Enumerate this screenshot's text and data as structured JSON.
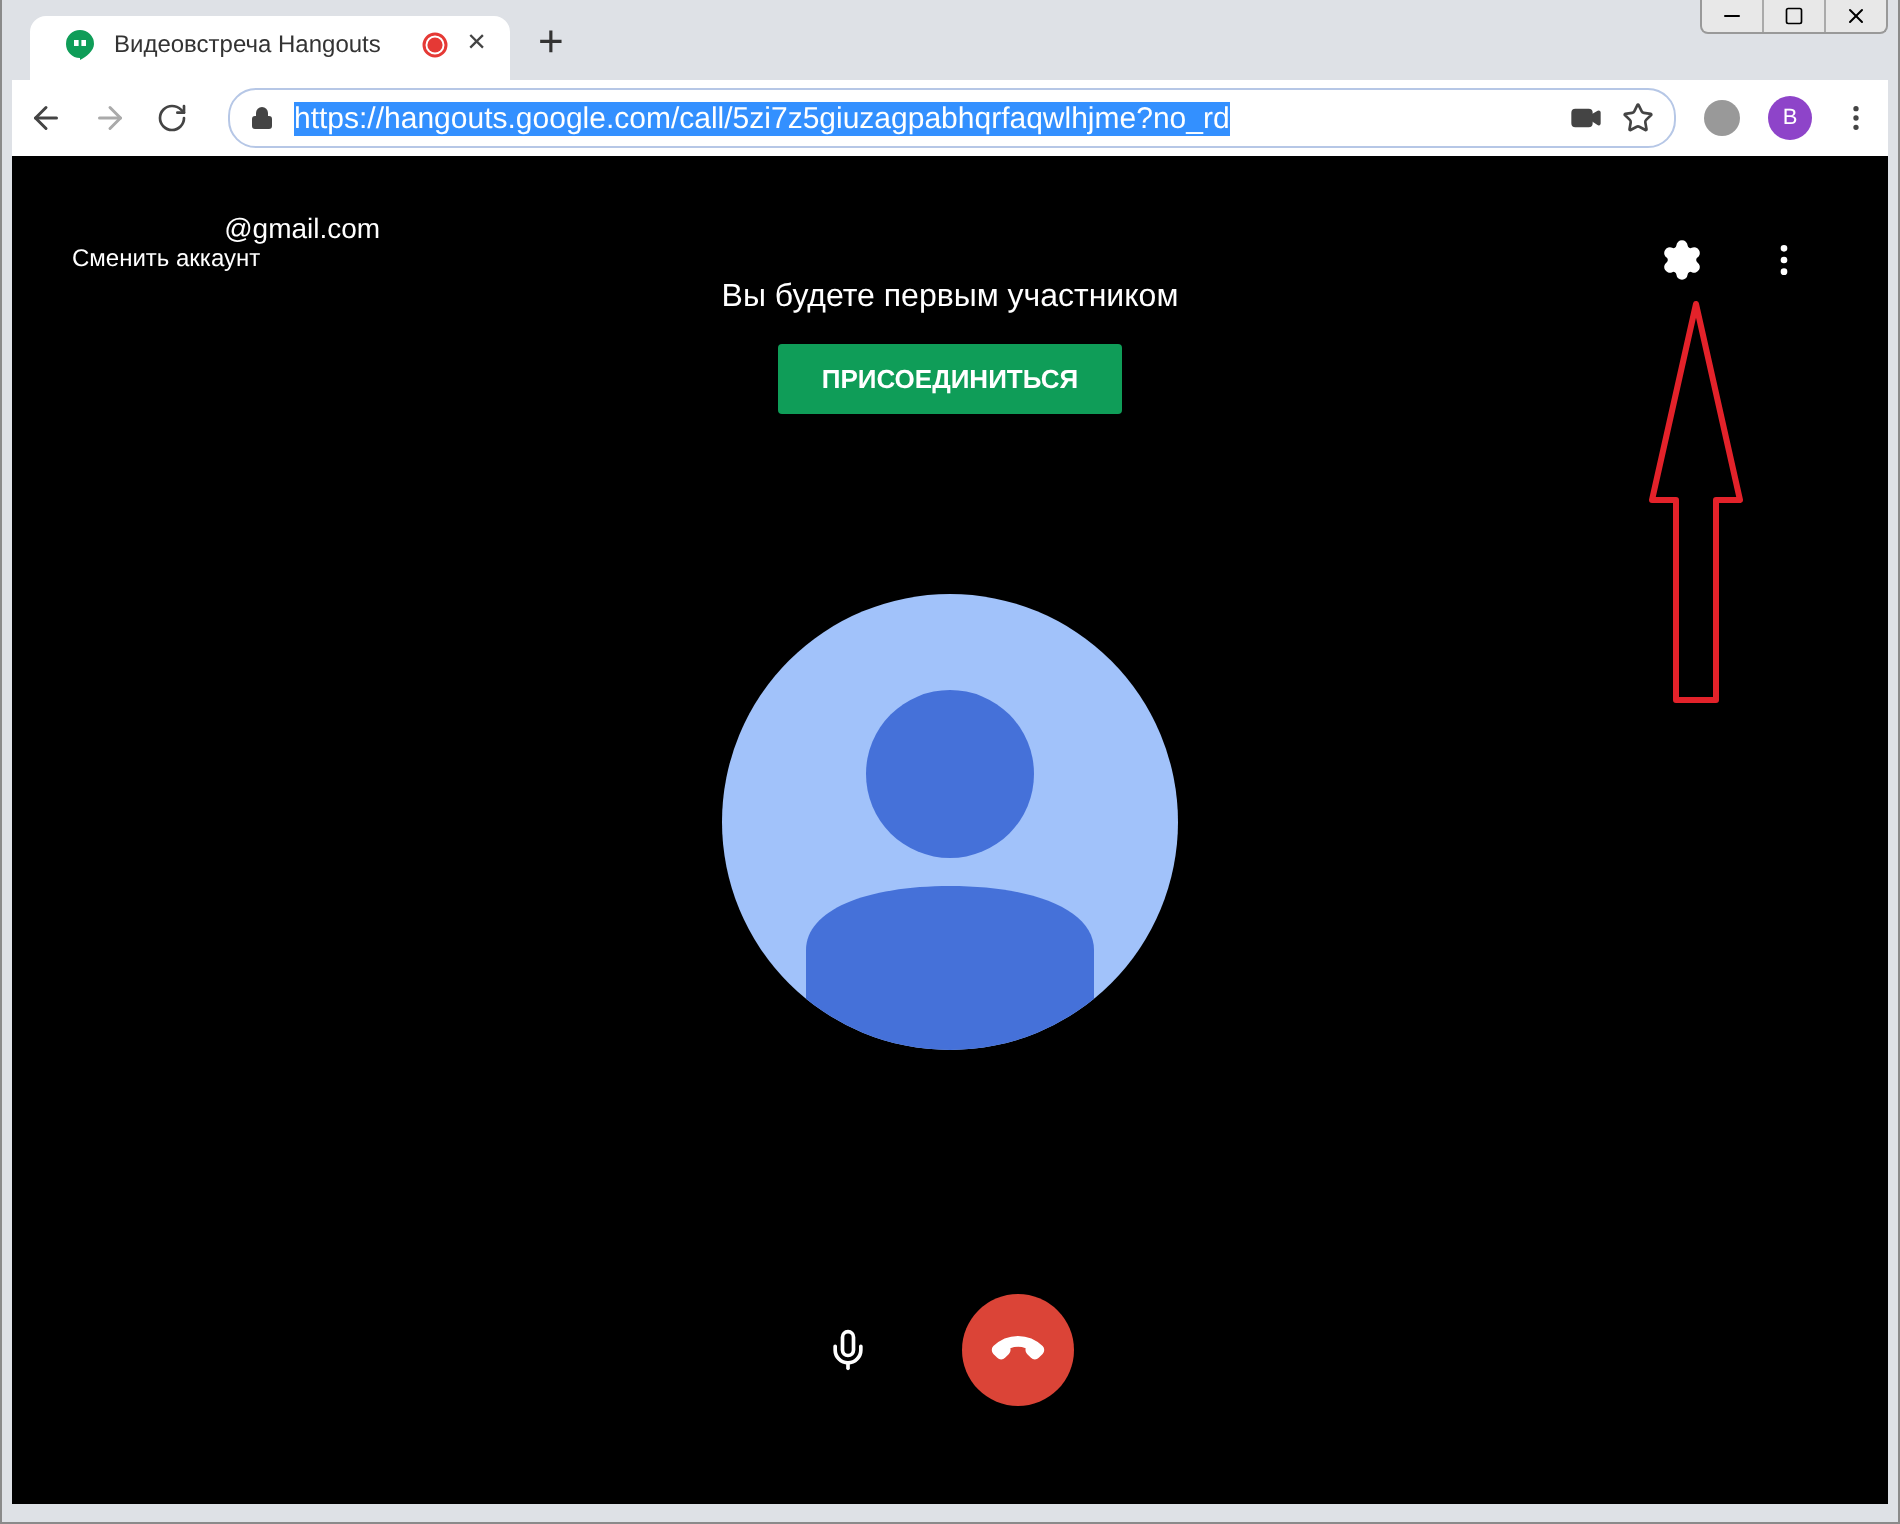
{
  "tab": {
    "title": "Видеовстреча Hangouts",
    "close": "×"
  },
  "new_tab": "+",
  "address_bar": {
    "url": "https://hangouts.google.com/call/5zi7z5giuzagpabhqrfaqwlhjme?no_rd",
    "selected": true
  },
  "profile": {
    "initial": "B"
  },
  "account": {
    "email": "@gmail.com",
    "switch_link": "Сменить аккаунт"
  },
  "call": {
    "message": "Вы будете первым участником",
    "join_button": "ПРИСОЕДИНИТЬСЯ"
  }
}
